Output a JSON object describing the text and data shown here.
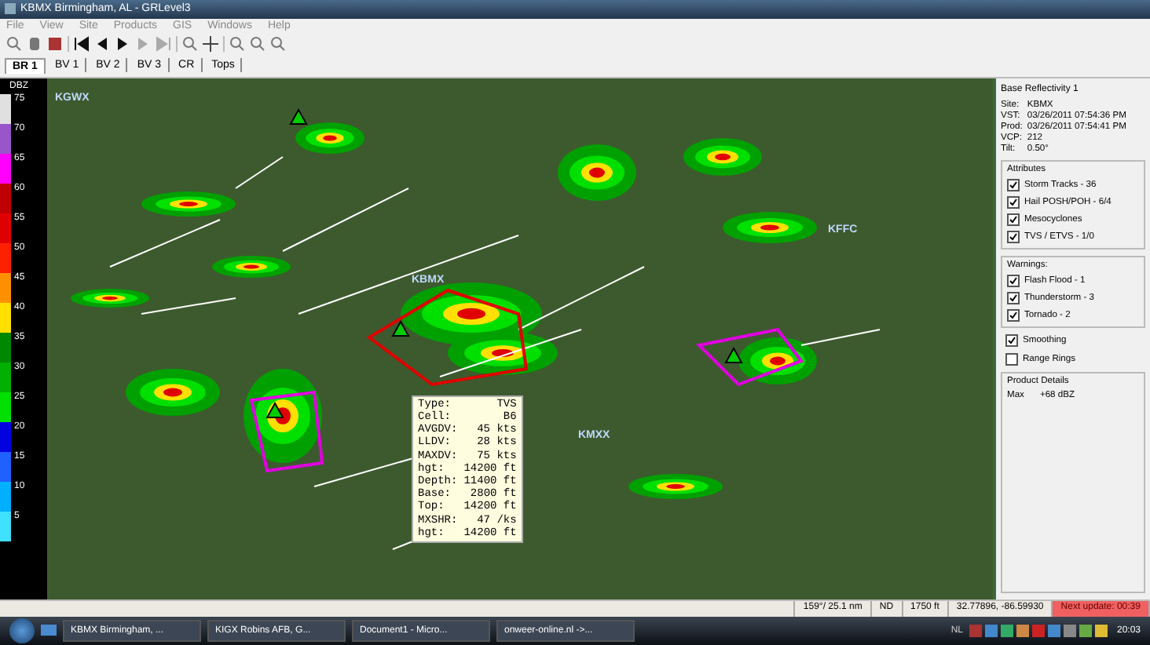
{
  "window": {
    "title": "KBMX Birmingham, AL - GRLevel3"
  },
  "menu": [
    "File",
    "View",
    "Site",
    "Products",
    "GIS",
    "Windows",
    "Help"
  ],
  "tabs": [
    {
      "label": "BR 1",
      "selected": true
    },
    {
      "label": "BV 1",
      "selected": false
    },
    {
      "label": "BV 2",
      "selected": false
    },
    {
      "label": "BV 3",
      "selected": false
    },
    {
      "label": "CR",
      "selected": false
    },
    {
      "label": "Tops",
      "selected": false
    }
  ],
  "legend": {
    "title": "DBZ",
    "entries": [
      {
        "label": "75",
        "color": "#e0e0e0"
      },
      {
        "label": "70",
        "color": "#9955c9"
      },
      {
        "label": "65",
        "color": "#ff00ff"
      },
      {
        "label": "60",
        "color": "#c00000"
      },
      {
        "label": "55",
        "color": "#e00000"
      },
      {
        "label": "50",
        "color": "#ff2000"
      },
      {
        "label": "45",
        "color": "#ff9000"
      },
      {
        "label": "40",
        "color": "#ffe000"
      },
      {
        "label": "35",
        "color": "#008800"
      },
      {
        "label": "30",
        "color": "#00b000"
      },
      {
        "label": "25",
        "color": "#00e000"
      },
      {
        "label": "20",
        "color": "#0000e0"
      },
      {
        "label": "15",
        "color": "#2060ff"
      },
      {
        "label": "10",
        "color": "#00b0ff"
      },
      {
        "label": "5",
        "color": "#40e0ff"
      }
    ]
  },
  "map": {
    "stations": [
      {
        "label": "KGWX"
      },
      {
        "label": "KBMX"
      },
      {
        "label": "KMXX"
      },
      {
        "label": "KFFC"
      }
    ],
    "tooltip": [
      {
        "label": "Type:",
        "value": "TVS"
      },
      {
        "label": "Cell:",
        "value": "B6"
      },
      {
        "label": "AVGDV:",
        "value": "45 kts"
      },
      {
        "label": "LLDV:",
        "value": "28 kts"
      },
      {
        "label": "MAXDV:",
        "value": "75 kts"
      },
      {
        "label": "hgt:",
        "value": "14200 ft"
      },
      {
        "label": "Depth:",
        "value": "11400 ft"
      },
      {
        "label": "Base:",
        "value": "2800 ft"
      },
      {
        "label": "Top:",
        "value": "14200 ft"
      },
      {
        "label": "MXSHR:",
        "value": "47 /ks"
      },
      {
        "label": "hgt:",
        "value": "14200 ft"
      }
    ]
  },
  "panel": {
    "title": "Base Reflectivity 1",
    "info": [
      {
        "label": "Site:",
        "value": "KBMX"
      },
      {
        "label": "VST:",
        "value": "03/26/2011  07:54:36 PM"
      },
      {
        "label": "Prod:",
        "value": "03/26/2011  07:54:41 PM"
      },
      {
        "label": "VCP:",
        "value": "212"
      },
      {
        "label": "Tilt:",
        "value": "0.50°"
      }
    ],
    "groups": [
      {
        "title": "Attributes",
        "items": [
          {
            "label": "Storm Tracks - 36",
            "checked": true
          },
          {
            "label": "Hail POSH/POH - 6/4",
            "checked": true
          },
          {
            "label": "Mesocyclones",
            "checked": true
          },
          {
            "label": "TVS / ETVS - 1/0",
            "checked": true
          }
        ]
      },
      {
        "title": "Warnings:",
        "items": [
          {
            "label": "Flash Flood - 1",
            "checked": true
          },
          {
            "label": "Thunderstorm - 3",
            "checked": true
          },
          {
            "label": "Tornado - 2",
            "checked": true
          }
        ]
      }
    ],
    "options": [
      {
        "label": "Smoothing",
        "checked": true
      },
      {
        "label": "Range Rings",
        "checked": false
      }
    ],
    "details": {
      "title": "Product Details",
      "rows": [
        {
          "label": "Max",
          "value": "+68 dBZ"
        }
      ]
    }
  },
  "status_bar": {
    "fields": [
      "159°/ 25.1 nm",
      "ND",
      "1750 ft",
      "32.77896, -86.59930"
    ],
    "update": {
      "text": "Next update: 00:39",
      "alert": true
    }
  },
  "taskbar": {
    "tasks": [
      {
        "label": "KBMX Birmingham, ..."
      },
      {
        "label": "KIGX Robins AFB, G..."
      },
      {
        "label": "Document1 - Micro..."
      },
      {
        "label": "onweer-online.nl ->..."
      }
    ],
    "language": "NL",
    "clock": "20:03"
  }
}
